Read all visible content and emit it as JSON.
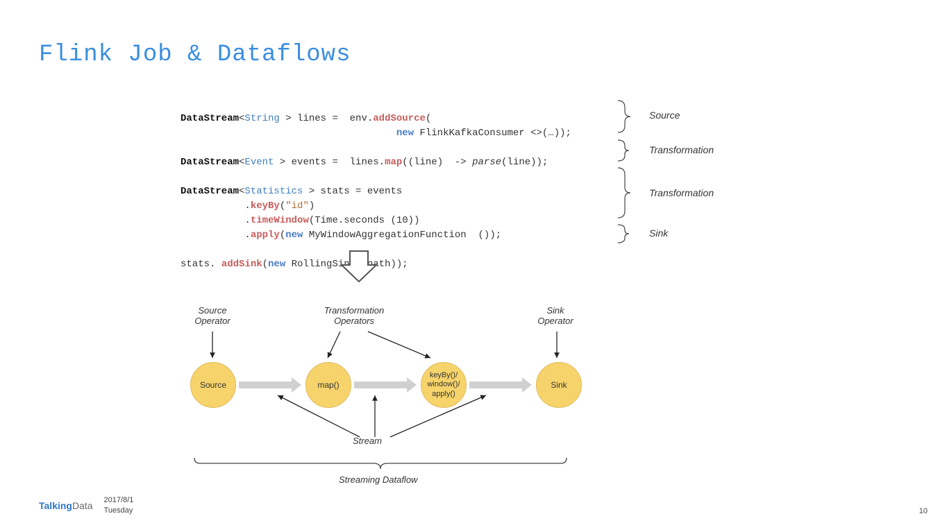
{
  "title": "Flink Job & Dataflows",
  "code": {
    "l1a": "DataStream",
    "l1b": "<",
    "l1c": "String",
    "l1d": " > lines =  env.",
    "l1e": "addSource",
    "l1f": "(",
    "l2a": "                                     ",
    "l2b": "new",
    "l2c": " FlinkKafkaConsumer <>(…));",
    "l3a": "DataStream",
    "l3b": "<",
    "l3c": "Event",
    "l3d": " > events =  lines.",
    "l3e": "map",
    "l3f": "((line)  -> ",
    "l3g": "parse",
    "l3h": "(line));",
    "l4a": "DataStream",
    "l4b": "<",
    "l4c": "Statistics",
    "l4d": " > stats = events",
    "l5a": "           .",
    "l5b": "keyBy",
    "l5c": "(",
    "l5d": "\"id\"",
    "l5e": ")",
    "l6a": "           .",
    "l6b": "timeWindow",
    "l6c": "(Time.seconds (10))",
    "l7a": "           .",
    "l7b": "apply",
    "l7c": "(",
    "l7d": "new",
    "l7e": " MyWindowAggregationFunction  ());",
    "l8a": "stats. ",
    "l8b": "addSink",
    "l8c": "(",
    "l8d": "new",
    "l8e": " RollingSink (path));"
  },
  "annotations": {
    "source": "Source",
    "trans1": "Transformation",
    "trans2": "Transformation",
    "sink": "Sink"
  },
  "diagram": {
    "source_op": "Source\nOperator",
    "trans_ops": "Transformation\nOperators",
    "sink_op": "Sink\nOperator",
    "node_source": "Source",
    "node_map": "map()",
    "node_kby": "keyBy()/\nwindow()/\napply()",
    "node_sink": "Sink",
    "stream": "Stream",
    "streaming_dataflow": "Streaming Dataflow"
  },
  "footer": {
    "logo1": "Talking",
    "logo2": "Data",
    "date": "2017/8/1",
    "day": "Tuesday",
    "page": "10"
  }
}
